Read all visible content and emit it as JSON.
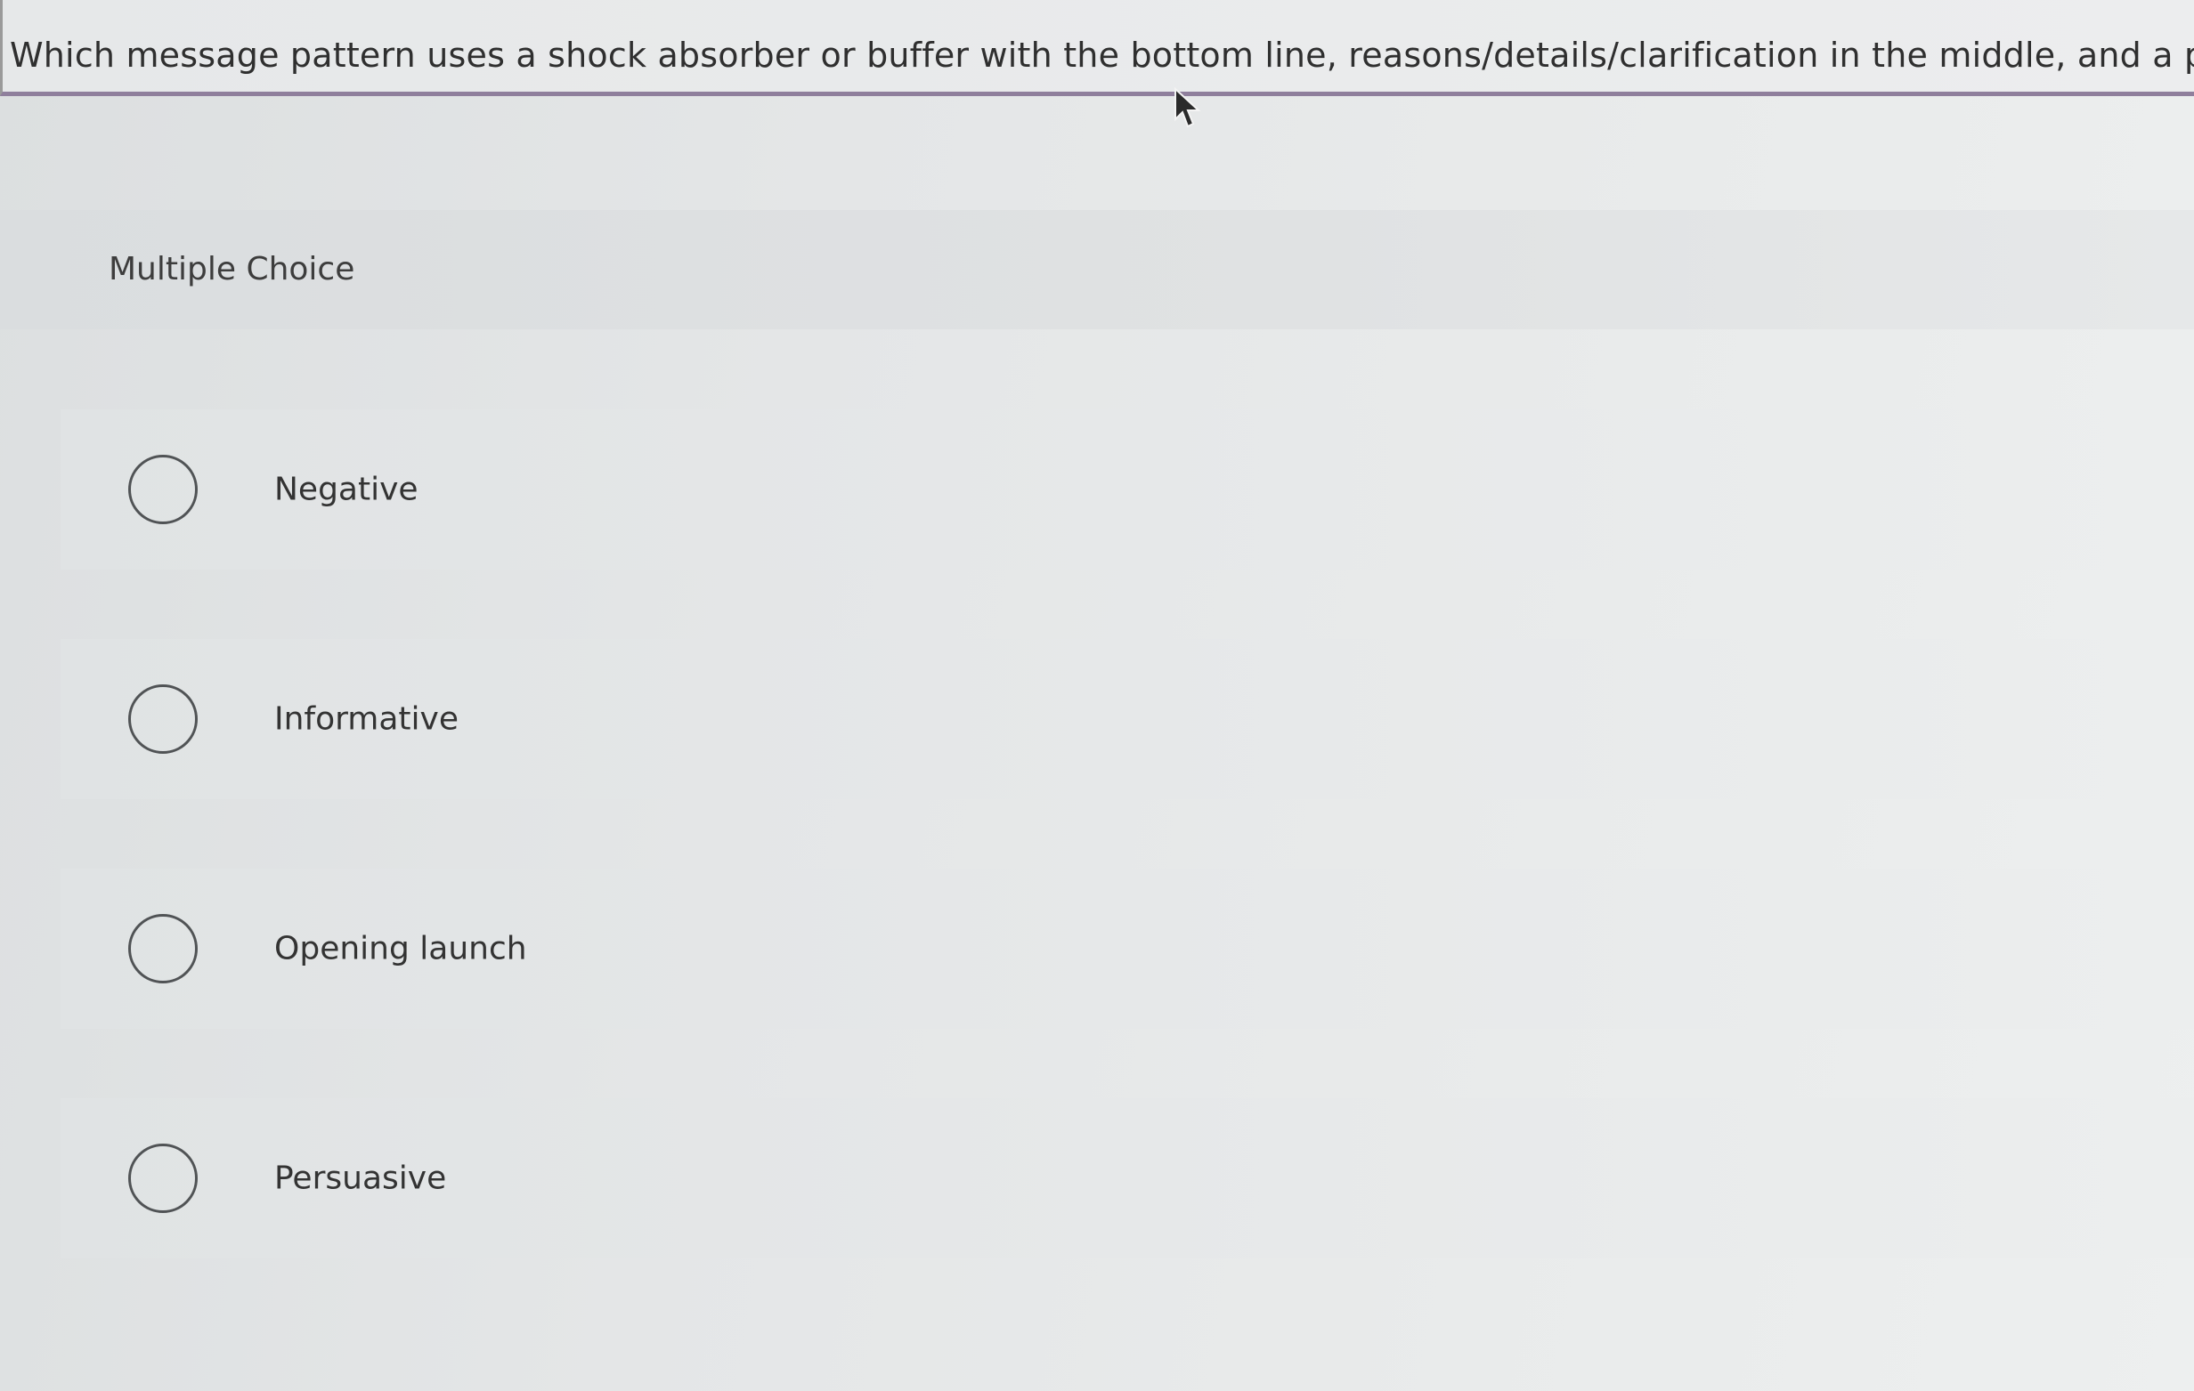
{
  "question": {
    "text": "Which message pattern uses a shock absorber or buffer with the bottom line, reasons/details/clarification in the middle, and a posi"
  },
  "section": {
    "label": "Multiple Choice"
  },
  "options": [
    {
      "label": "Negative",
      "selected": false
    },
    {
      "label": "Informative",
      "selected": false
    },
    {
      "label": "Opening launch",
      "selected": false
    },
    {
      "label": "Persuasive",
      "selected": false
    }
  ],
  "colors": {
    "accent_underline": "#8f7f9c",
    "radio_border": "#505355"
  },
  "icons": {
    "cursor": "mouse-pointer-icon"
  }
}
